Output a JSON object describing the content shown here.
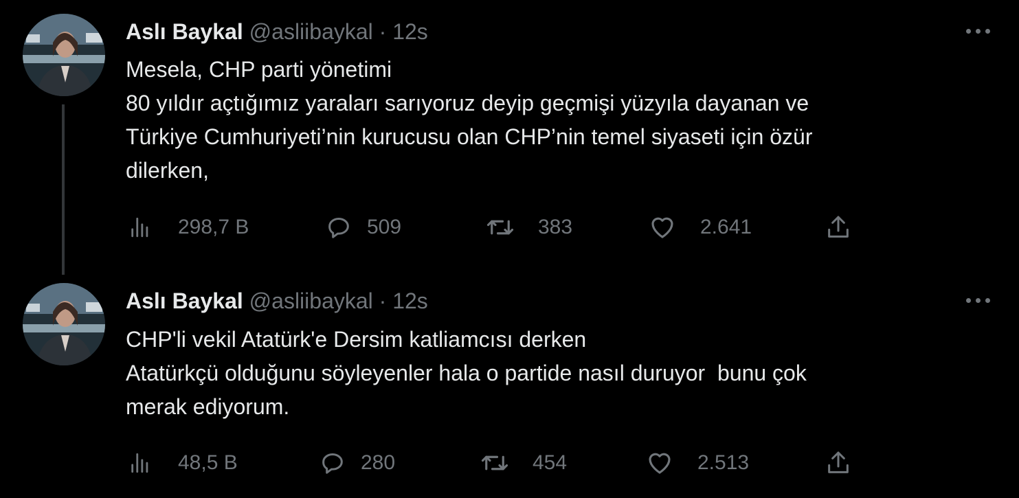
{
  "tweets": [
    {
      "author_name": "Aslı Baykal",
      "handle": "@asliibaykal",
      "separator": "·",
      "time": "12s",
      "lines": [
        "Mesela, CHP parti yönetimi",
        "80 yıldır açtığımız yaraları sarıyoruz deyip geçmişi yüzyıla dayanan ve",
        "Türkiye Cumhuriyeti’nin kurucusu olan CHP’nin temel siyaseti için özür",
        "dilerken,"
      ],
      "views": "298,7 B",
      "replies": "509",
      "retweets": "383",
      "likes": "2.641"
    },
    {
      "author_name": "Aslı Baykal",
      "handle": "@asliibaykal",
      "separator": "·",
      "time": "12s",
      "lines": [
        "CHP'li vekil Atatürk'e Dersim katliamcısı derken",
        "Atatürkçü olduğunu söyleyenler hala o partide nasıl duruyor  bunu çok",
        "merak ediyorum."
      ],
      "views": "48,5 B",
      "replies": "280",
      "retweets": "454",
      "likes": "2.513"
    }
  ],
  "icons": {
    "views": "bar-chart-icon",
    "reply": "speech-bubble-icon",
    "retweet": "retweet-icon",
    "like": "heart-icon",
    "share": "share-upload-icon",
    "more": "more-horizontal-icon"
  },
  "colors": {
    "background": "#000000",
    "text": "#e7e9ea",
    "secondary": "#71767b",
    "thread_line": "#333639"
  }
}
